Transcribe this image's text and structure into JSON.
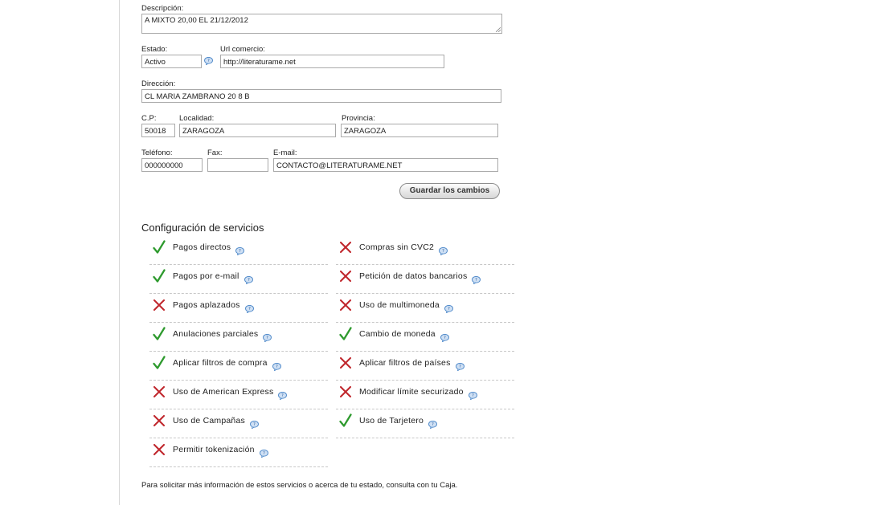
{
  "form": {
    "descripcion": {
      "label": "Descripción:",
      "value": "A MIXTO 20,00 EL 21/12/2012"
    },
    "estado": {
      "label": "Estado:",
      "value": "Activo"
    },
    "url": {
      "label": "Url comercio:",
      "value": "http://literaturame.net"
    },
    "direccion": {
      "label": "Dirección:",
      "value": "CL MARIA ZAMBRANO 20 8 B"
    },
    "cp": {
      "label": "C.P:",
      "value": "50018"
    },
    "localidad": {
      "label": "Localidad:",
      "value": "ZARAGOZA"
    },
    "provincia": {
      "label": "Provincia:",
      "value": "ZARAGOZA"
    },
    "telefono": {
      "label": "Teléfono:",
      "value": "000000000"
    },
    "fax": {
      "label": "Fax:",
      "value": ""
    },
    "email": {
      "label": "E-mail:",
      "value": "CONTACTO@LITERATURAME.NET"
    },
    "save_label": "Guardar los cambios"
  },
  "services": {
    "title": "Configuración de servicios",
    "left": [
      {
        "name": "Pagos directos",
        "enabled": true
      },
      {
        "name": "Pagos por e-mail",
        "enabled": true
      },
      {
        "name": "Pagos aplazados",
        "enabled": false
      },
      {
        "name": "Anulaciones parciales",
        "enabled": true
      },
      {
        "name": "Aplicar filtros de compra",
        "enabled": true
      },
      {
        "name": "Uso de American Express",
        "enabled": false
      },
      {
        "name": "Uso de Campañas",
        "enabled": false
      },
      {
        "name": "Permitir tokenización",
        "enabled": false
      }
    ],
    "right": [
      {
        "name": "Compras sin CVC2",
        "enabled": false
      },
      {
        "name": "Petición de datos bancarios",
        "enabled": false
      },
      {
        "name": "Uso de multimoneda",
        "enabled": false
      },
      {
        "name": "Cambio de moneda",
        "enabled": true
      },
      {
        "name": "Aplicar filtros de países",
        "enabled": false
      },
      {
        "name": "Modificar límite securizado",
        "enabled": false
      },
      {
        "name": "Uso de Tarjetero",
        "enabled": true
      }
    ]
  },
  "footer": "Para solicitar más información de estos servicios o acerca de tu estado, consulta con tu Caja.",
  "colors": {
    "check": "#2e9a2e",
    "cross": "#c0272d",
    "help": "#4a86c8"
  },
  "icons": {
    "enabled": "check-icon",
    "disabled": "cross-icon",
    "help": "help-bubble-icon"
  }
}
